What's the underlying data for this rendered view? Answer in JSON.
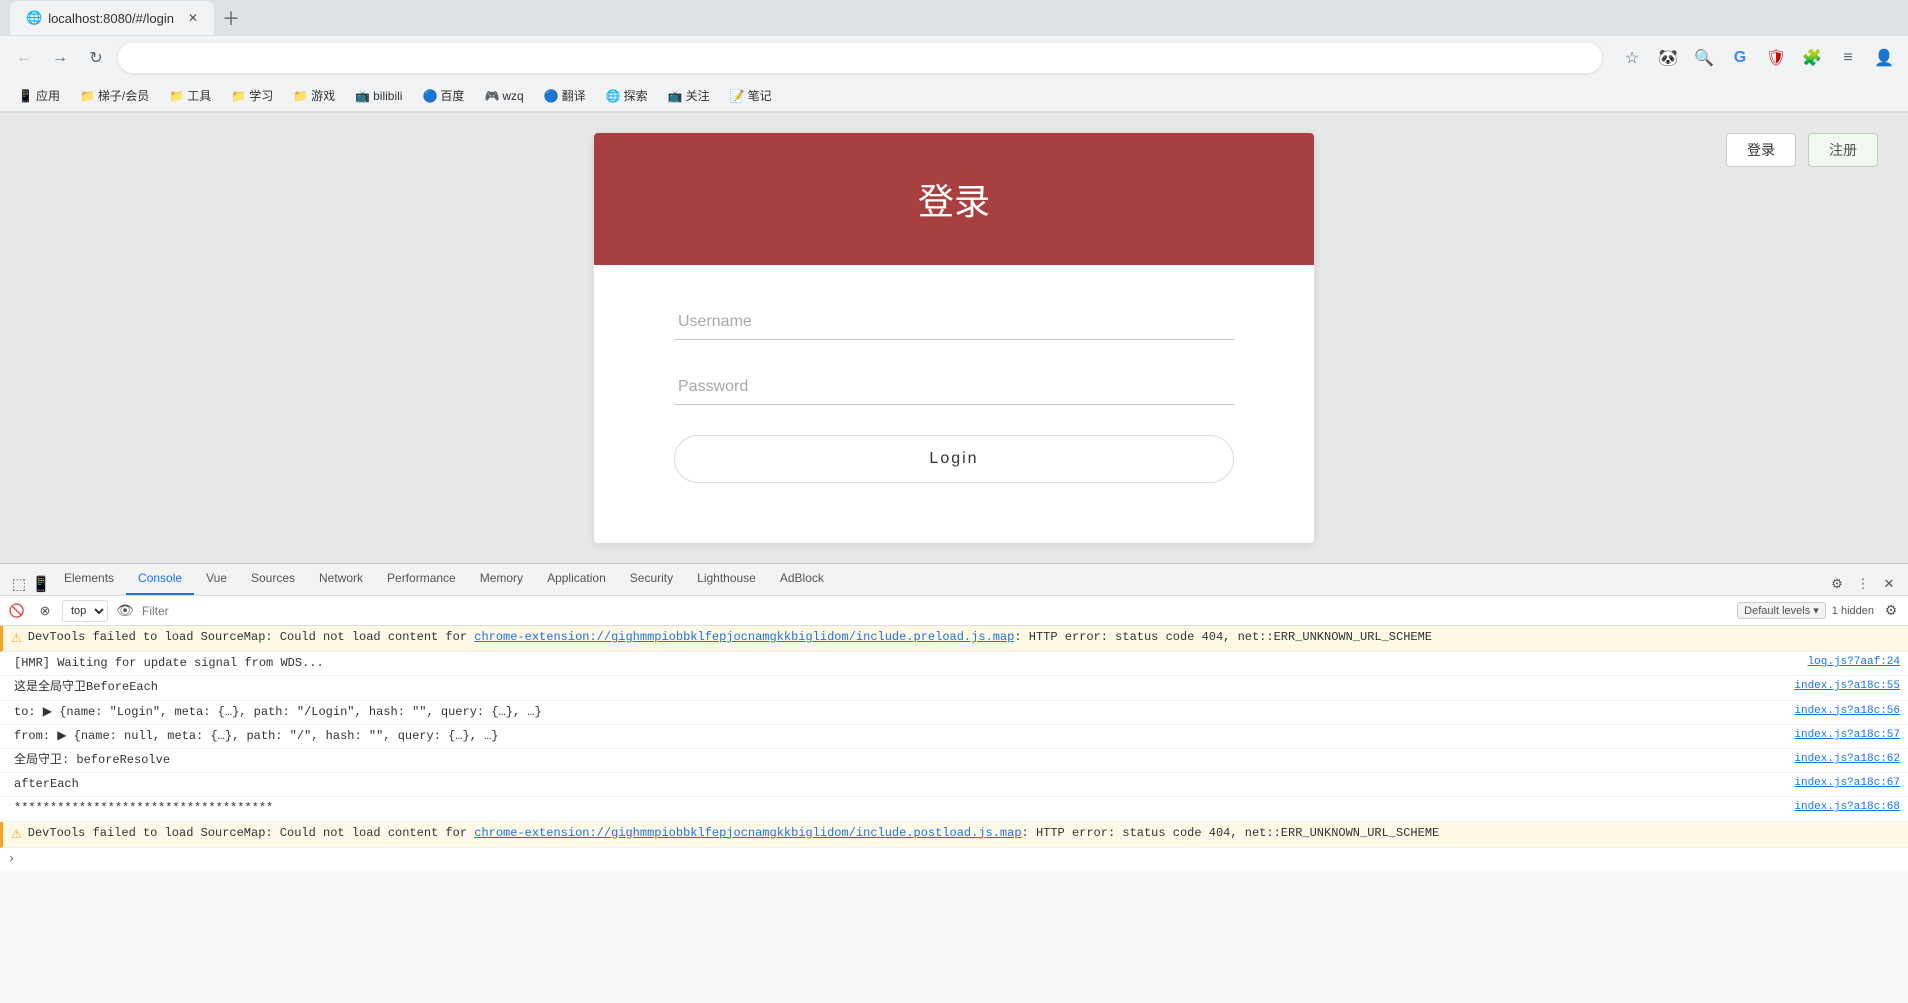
{
  "browser": {
    "url": "localhost:8080/#/login",
    "tab_title": "localhost:8080/#/login"
  },
  "bookmarks": [
    {
      "label": "应用",
      "icon": "📱"
    },
    {
      "label": "梯子/会员",
      "icon": "📁"
    },
    {
      "label": "工具",
      "icon": "📁"
    },
    {
      "label": "学习",
      "icon": "📁"
    },
    {
      "label": "游戏",
      "icon": "📁"
    },
    {
      "label": "bilibili",
      "icon": "📺"
    },
    {
      "label": "百度",
      "icon": "🔵"
    },
    {
      "label": "wzq",
      "icon": "🎮"
    },
    {
      "label": "翻译",
      "icon": "🔵"
    },
    {
      "label": "探索",
      "icon": "🌐"
    },
    {
      "label": "关注",
      "icon": "📺"
    },
    {
      "label": "笔记",
      "icon": "📝"
    }
  ],
  "top_buttons": {
    "login_label": "登录",
    "register_label": "注册"
  },
  "login_card": {
    "header_title": "登录",
    "username_placeholder": "Username",
    "password_placeholder": "Password",
    "login_button_label": "Login"
  },
  "devtools": {
    "tabs": [
      {
        "label": "Elements",
        "active": false
      },
      {
        "label": "Console",
        "active": true
      },
      {
        "label": "Vue",
        "active": false
      },
      {
        "label": "Sources",
        "active": false
      },
      {
        "label": "Network",
        "active": false
      },
      {
        "label": "Performance",
        "active": false
      },
      {
        "label": "Memory",
        "active": false
      },
      {
        "label": "Application",
        "active": false
      },
      {
        "label": "Security",
        "active": false
      },
      {
        "label": "Lighthouse",
        "active": false
      },
      {
        "label": "AdBlock",
        "active": false
      }
    ],
    "filter_bar": {
      "top_select_value": "top",
      "filter_placeholder": "Filter",
      "default_levels_label": "Default levels ▾",
      "hidden_count": "1 hidden"
    },
    "logs": [
      {
        "type": "warning",
        "text": "DevTools failed to load SourceMap: Could not load content for ",
        "link_text": "chrome-extension://gighmmpiobbklfepjocnamgkkbiglidom/include.preload.js.map",
        "text_after": ": HTTP error: status code 404, net::ERR_UNKNOWN_URL_SCHEME",
        "source": ""
      },
      {
        "type": "normal",
        "text": "[HMR] Waiting for update signal from WDS...",
        "source": "log.js?7aaf:24"
      },
      {
        "type": "normal",
        "text": "这是全局守卫BeforeEach",
        "source": "index.js?a18c:55"
      },
      {
        "type": "normal",
        "text": "to: ▶ {name: \"Login\", meta: {…}, path: \"/Login\", hash: \"\", query: {…}, …}",
        "source": "index.js?a18c:56"
      },
      {
        "type": "normal",
        "text": "from: ▶ {name: null, meta: {…}, path: \"/\", hash: \"\", query: {…}, …}",
        "source": "index.js?a18c:57"
      },
      {
        "type": "normal",
        "text": "全局守卫: beforeResolve",
        "source": "index.js?a18c:62"
      },
      {
        "type": "normal",
        "text": "afterEach",
        "source": "index.js?a18c:67"
      },
      {
        "type": "normal",
        "text": "************************************",
        "source": "index.js?a18c:68"
      },
      {
        "type": "warning",
        "text": "DevTools failed to load SourceMap: Could not load content for ",
        "link_text": "chrome-extension://gighmmpiobbklfepjocnamgkkbiglidom/include.postload.js.map",
        "text_after": ": HTTP error: status code 404, net::ERR_UNKNOWN_URL_SCHEME",
        "source": ""
      }
    ]
  }
}
